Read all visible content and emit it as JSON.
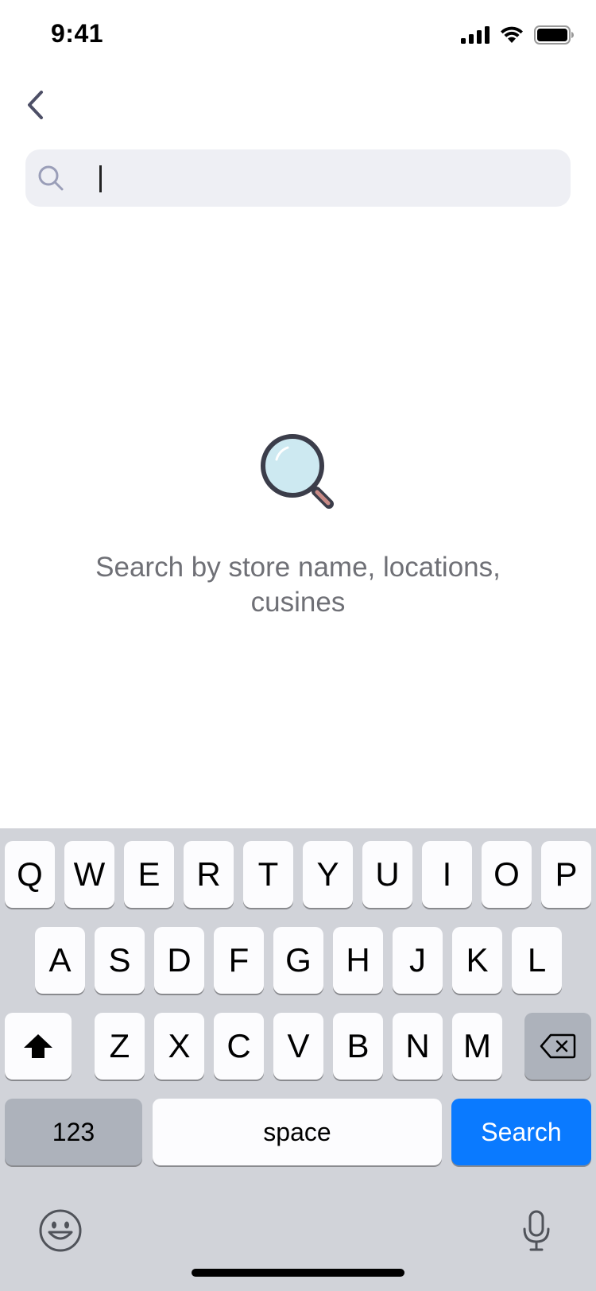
{
  "status_bar": {
    "time": "9:41"
  },
  "search": {
    "value": "",
    "placeholder": ""
  },
  "empty_state": {
    "message": "Search by store name, locations, cusines"
  },
  "keyboard": {
    "row1": [
      "Q",
      "W",
      "E",
      "R",
      "T",
      "Y",
      "U",
      "I",
      "O",
      "P"
    ],
    "row2": [
      "A",
      "S",
      "D",
      "F",
      "G",
      "H",
      "J",
      "K",
      "L"
    ],
    "row3": [
      "Z",
      "X",
      "C",
      "V",
      "B",
      "N",
      "M"
    ],
    "numbers_label": "123",
    "space_label": "space",
    "return_label": "Search"
  },
  "colors": {
    "accent": "#0a7aff",
    "search_bg": "#eeeff4",
    "keyboard_bg": "#d1d3d9",
    "muted_text": "#6f7076"
  }
}
